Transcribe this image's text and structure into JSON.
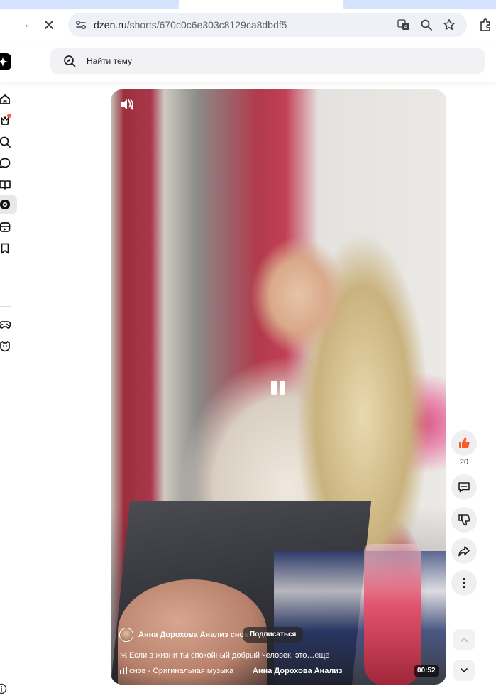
{
  "browser": {
    "url_host": "dzen.ru",
    "url_path": "/shorts/670c0c6e303c8129ca8dbdf5"
  },
  "header": {
    "search_placeholder": "Найти тему"
  },
  "sidebar": {
    "items": [
      "home-icon",
      "notifications-icon",
      "search-icon",
      "chat-icon",
      "articles-icon",
      "shorts-icon",
      "video-icon",
      "bookmark-icon",
      "games-icon",
      "kids-icon"
    ],
    "active": "shorts-icon"
  },
  "video": {
    "author": "Анна Дорохова Анализ снов",
    "subscribe_label": "Подписаться",
    "caption_emoji": "🕉",
    "caption": "Если в жизни ты спокойный добрый человек, это…",
    "caption_more": "еще",
    "music": "снов - Оригинальная музыка",
    "music_author": "Анна Дорохова Анализ",
    "duration": "00:52"
  },
  "actions": {
    "like_count": "20",
    "like_color": "#ff5a2c"
  }
}
